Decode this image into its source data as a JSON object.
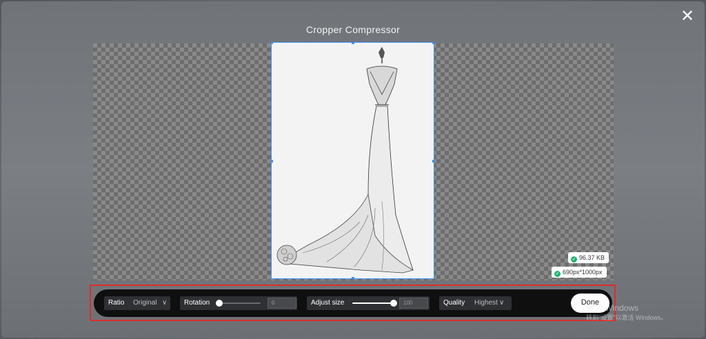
{
  "dialog": {
    "title": "Cropper Compressor",
    "close_icon": "close-icon",
    "close_glyph": "✕"
  },
  "preview": {
    "file_size": "96.37 KB",
    "dimensions": "690px*1000px",
    "accent_color": "#3b8ff5",
    "badge_icon": "check-circle-icon"
  },
  "toolbar": {
    "ratio_label": "Ratio",
    "ratio_value": "Original",
    "rotation_label": "Rotation",
    "rotation_value": "0",
    "rotation_fraction": 0.0,
    "adjust_label": "Adjust size",
    "adjust_value": "100",
    "adjust_fraction": 1.0,
    "quality_label": "Quality",
    "quality_value": "Highest",
    "chevron_glyph": "∨",
    "done_label": "Done"
  },
  "watermark": {
    "line1": "激活 Windows",
    "line2": "转到\"设置\"以激活 Windows。"
  }
}
